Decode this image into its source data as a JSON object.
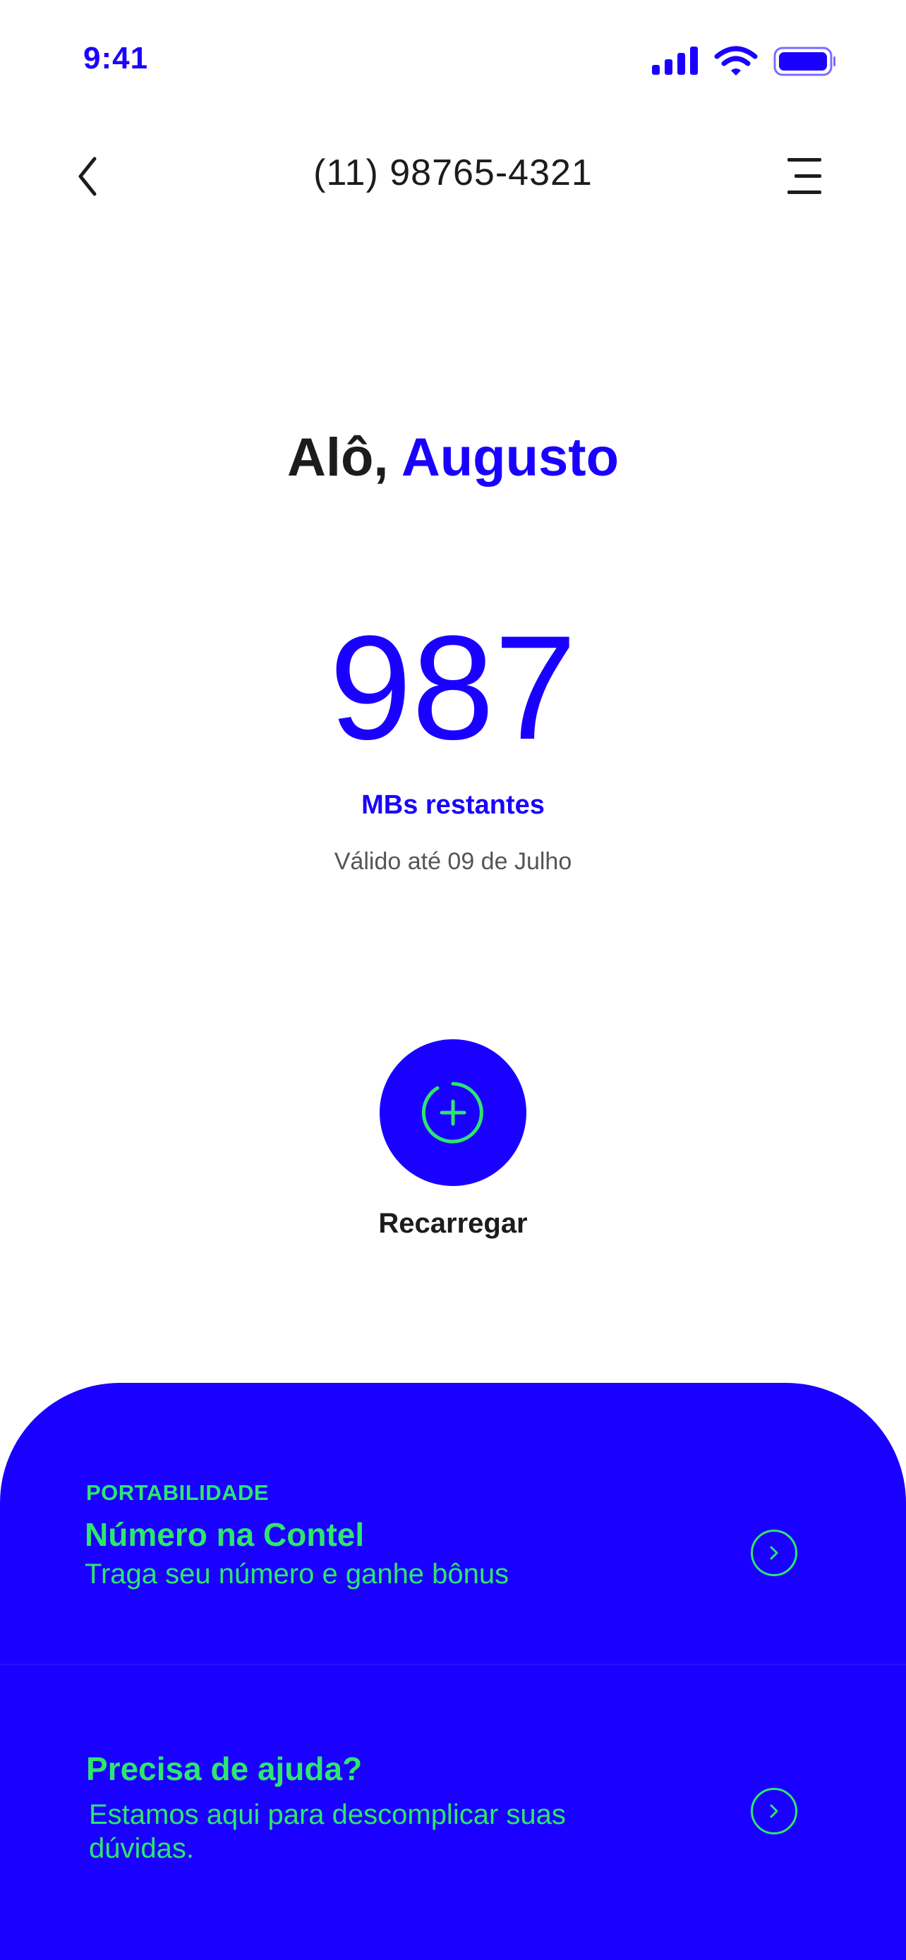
{
  "status_bar": {
    "time": "9:41",
    "icons": [
      "signal-icon",
      "wifi-icon",
      "battery-icon"
    ]
  },
  "header": {
    "phone_number": "(11) 98765-4321",
    "back_icon": "chevron-left-icon",
    "menu_icon": "menu-icon"
  },
  "greeting": {
    "prefix": "Alô,",
    "name": "Augusto"
  },
  "balance": {
    "value": "987",
    "unit": "MBs restantes",
    "validity": "Válido até 09 de Julho"
  },
  "recharge": {
    "label": "Recarregar",
    "icon": "plus-circle-icon"
  },
  "cards": [
    {
      "eyebrow": "PORTABILIDADE",
      "title": "Número na Contel",
      "subtitle": "Traga seu número e ganhe bônus",
      "icon": "chevron-right-circle-icon"
    },
    {
      "title": "Precisa de ajuda?",
      "subtitle": "Estamos aqui para descomplicar suas dúvidas.",
      "icon": "chevron-right-circle-icon"
    }
  ],
  "colors": {
    "brand_blue": "#1a00ff",
    "accent_green": "#2ee66e",
    "text_dark": "#1c1c1c",
    "text_muted": "#555555",
    "background": "#ffffff"
  }
}
